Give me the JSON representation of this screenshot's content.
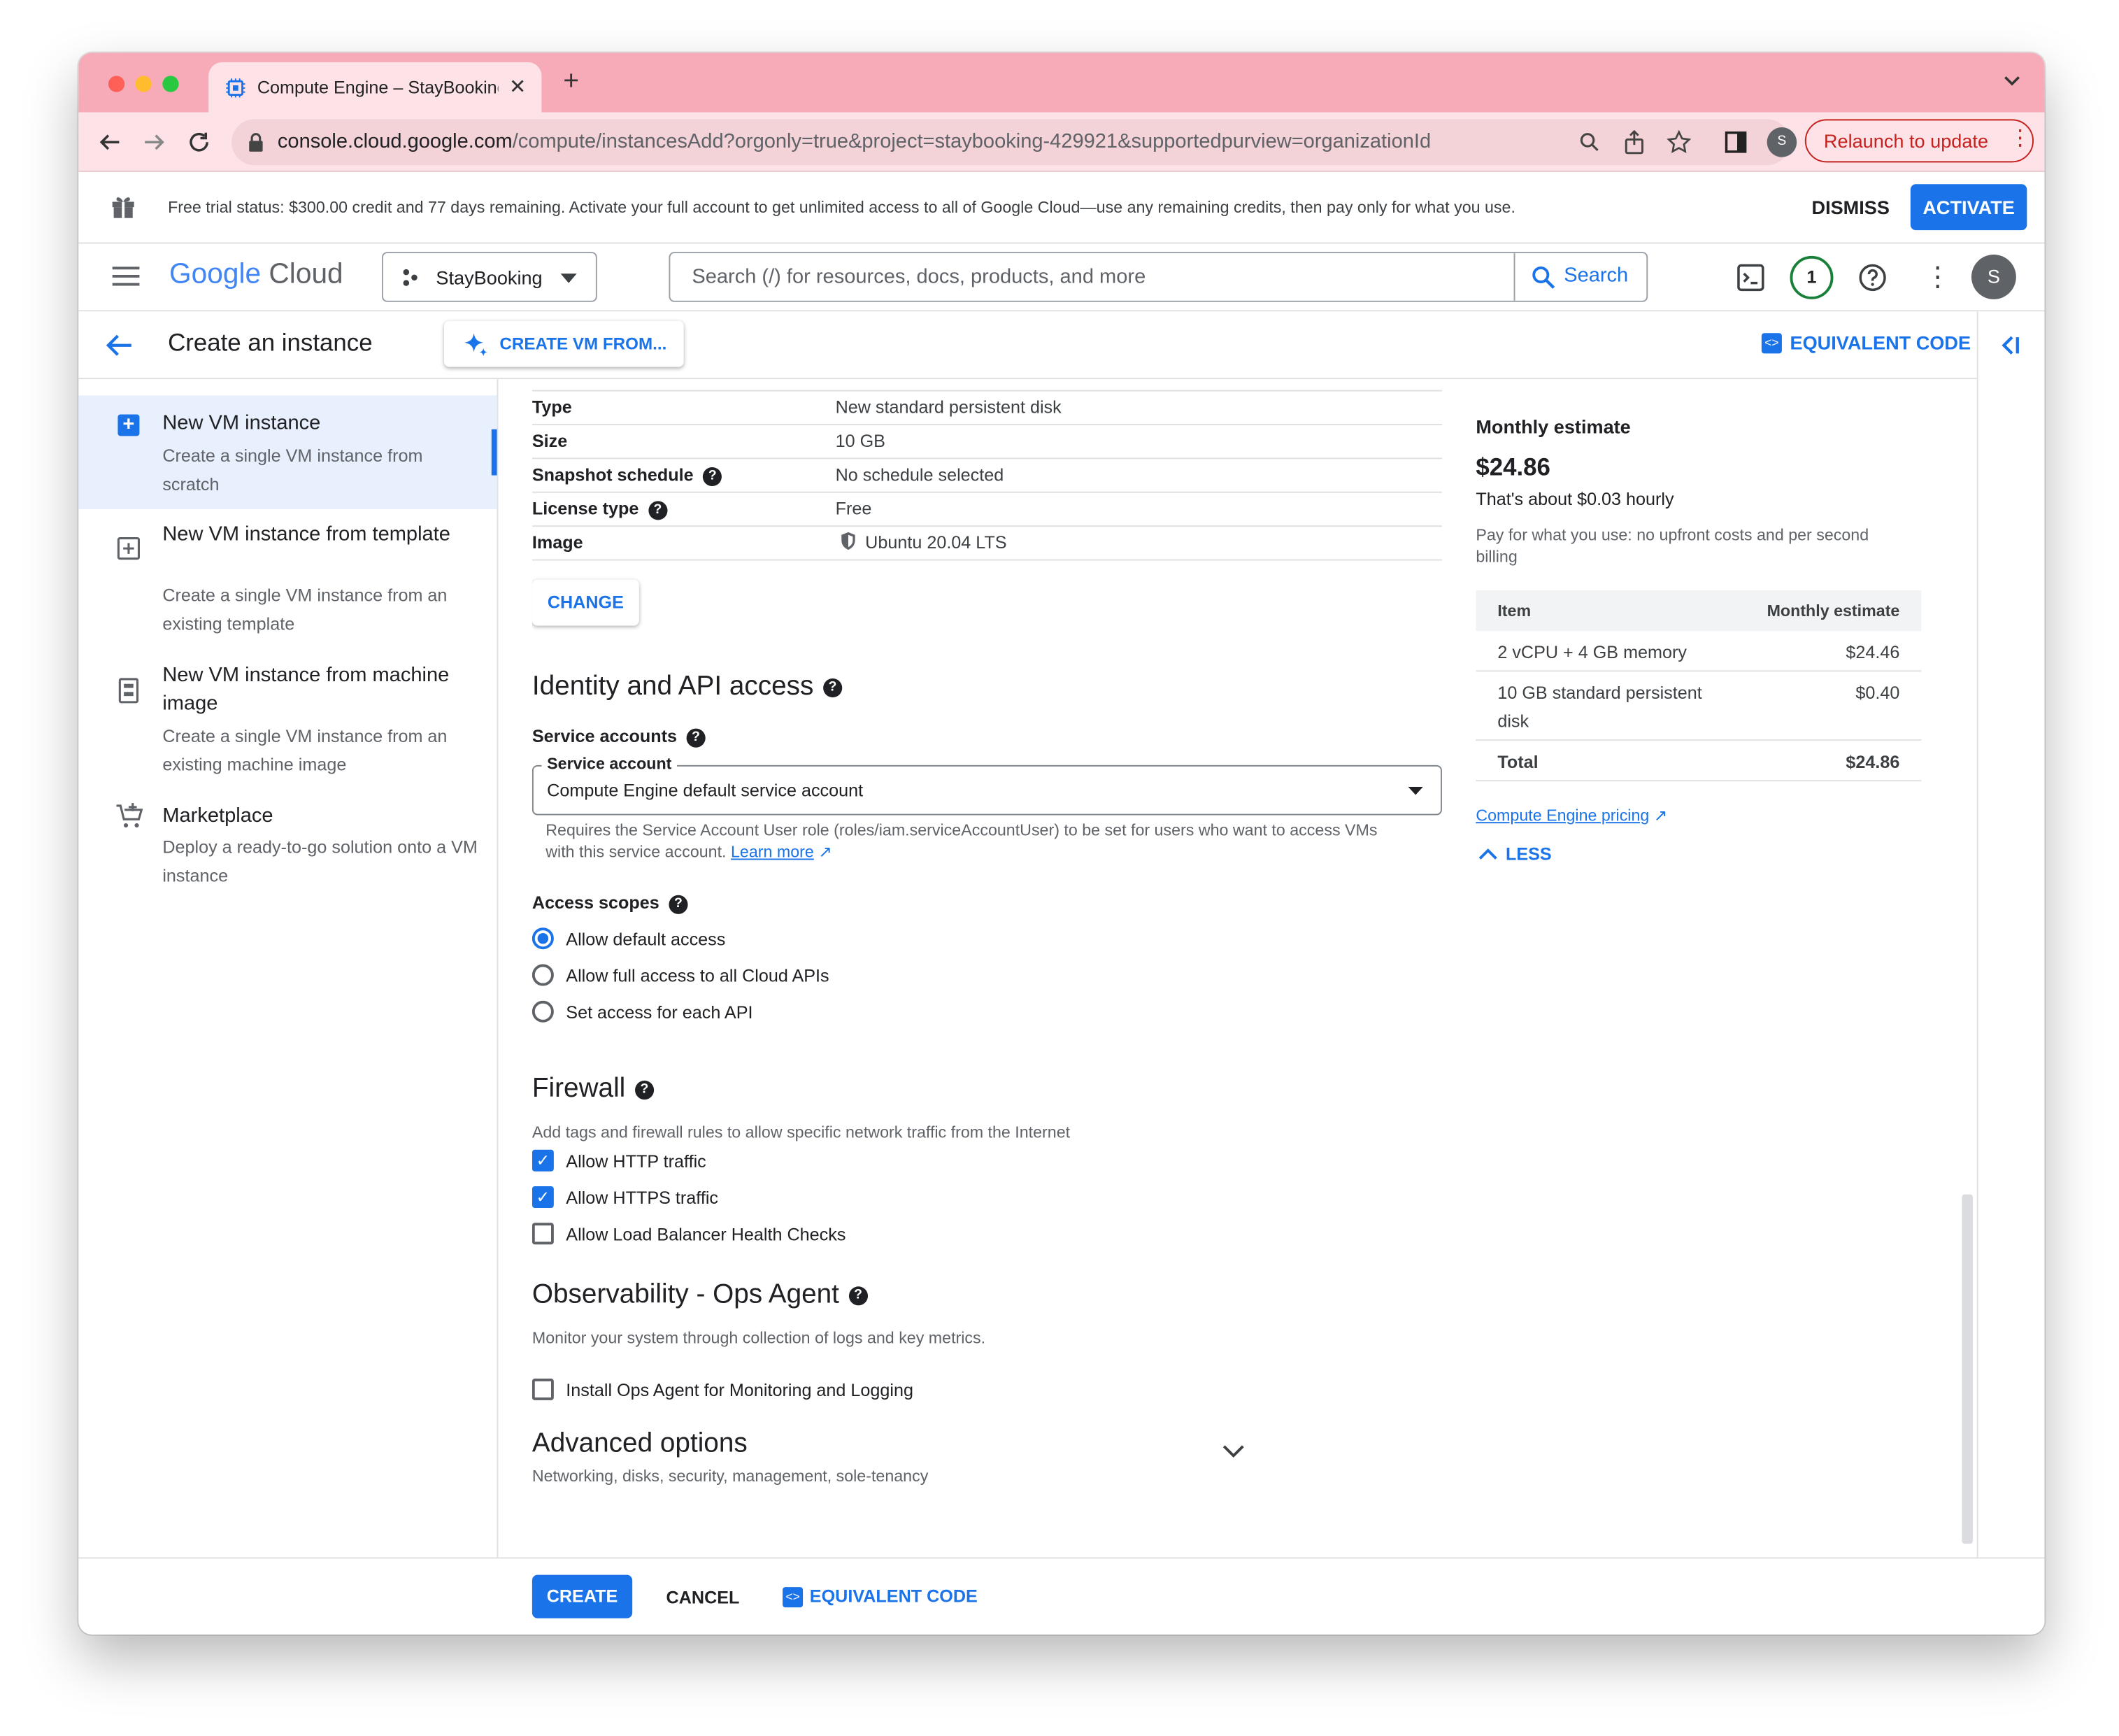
{
  "browser": {
    "tab_title": "Compute Engine – StayBooking",
    "url_host": "console.cloud.google.com",
    "url_path": "/compute/instancesAdd?orgonly=true&project=staybooking-429921&supportedpurview=organizationId",
    "profile_initial": "S",
    "relaunch_label": "Relaunch to update"
  },
  "trial": {
    "text": "Free trial status: $300.00 credit and 77 days remaining. Activate your full account to get unlimited access to all of Google Cloud—use any remaining credits, then pay only for what you use.",
    "dismiss": "DISMISS",
    "activate": "ACTIVATE"
  },
  "header": {
    "logo_google": "Google",
    "logo_cloud": "Cloud",
    "project": "StayBooking",
    "search_placeholder": "Search (/) for resources, docs, products, and more",
    "search_button": "Search",
    "notification_count": "1",
    "avatar_initial": "S"
  },
  "subheader": {
    "title": "Create an instance",
    "create_vm_from": "CREATE VM FROM...",
    "equivalent_code": "EQUIVALENT CODE"
  },
  "nav": [
    {
      "title": "New VM instance",
      "desc": "Create a single VM instance from scratch"
    },
    {
      "title": "New VM instance from template",
      "desc": "Create a single VM instance from an existing template"
    },
    {
      "title": "New VM instance from machine image",
      "desc": "Create a single VM instance from an existing machine image"
    },
    {
      "title": "Marketplace",
      "desc": "Deploy a ready-to-go solution onto a VM instance"
    }
  ],
  "disk": {
    "rows": [
      {
        "label": "Type",
        "value": "New standard persistent disk"
      },
      {
        "label": "Size",
        "value": "10 GB"
      },
      {
        "label": "Snapshot schedule",
        "value": "No schedule selected"
      },
      {
        "label": "License type",
        "value": "Free"
      },
      {
        "label": "Image",
        "value": "Ubuntu 20.04 LTS"
      }
    ],
    "change": "CHANGE"
  },
  "identity": {
    "title": "Identity and API access",
    "service_accounts": "Service accounts",
    "sa_field_label": "Service account",
    "sa_value": "Compute Engine default service account",
    "sa_help_line1": "Requires the Service Account User role (roles/iam.serviceAccountUser) to be set for users who want to access VMs",
    "sa_help_line2": "with this service account.",
    "learn_more": "Learn more",
    "access_scopes": "Access scopes",
    "scopes": [
      "Allow default access",
      "Allow full access to all Cloud APIs",
      "Set access for each API"
    ]
  },
  "firewall": {
    "title": "Firewall",
    "desc": "Add tags and firewall rules to allow specific network traffic from the Internet",
    "options": [
      "Allow HTTP traffic",
      "Allow HTTPS traffic",
      "Allow Load Balancer Health Checks"
    ]
  },
  "ops": {
    "title": "Observability - Ops Agent",
    "desc": "Monitor your system through collection of logs and key metrics.",
    "option": "Install Ops Agent for Monitoring and Logging"
  },
  "advanced": {
    "title": "Advanced options",
    "desc": "Networking, disks, security, management, sole-tenancy"
  },
  "estimate": {
    "title": "Monthly estimate",
    "amount": "$24.86",
    "hourly": "That's about $0.03 hourly",
    "note_line1": "Pay for what you use: no upfront costs and per second",
    "note_line2": "billing",
    "col_item": "Item",
    "col_est": "Monthly estimate",
    "row1_item": "2 vCPU + 4 GB memory",
    "row1_val": "$24.46",
    "row2_item_line1": "10 GB standard persistent",
    "row2_item_line2": "disk",
    "row2_val": "$0.40",
    "total_label": "Total",
    "total_val": "$24.86",
    "pricing_link": "Compute Engine pricing",
    "less": "LESS"
  },
  "footer": {
    "create": "CREATE",
    "cancel": "CANCEL",
    "equivalent_code": "EQUIVALENT CODE"
  }
}
